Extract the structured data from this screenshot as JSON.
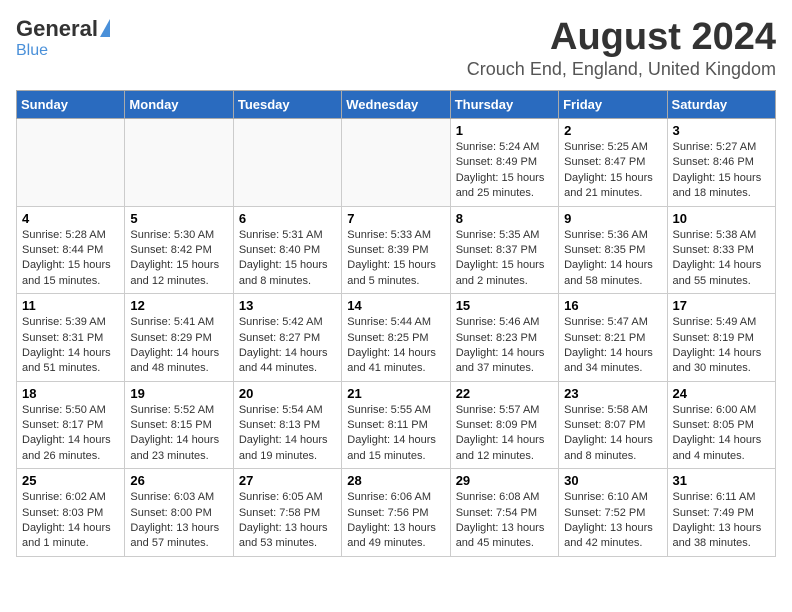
{
  "logo": {
    "general": "General",
    "blue": "Blue"
  },
  "header": {
    "month_year": "August 2024",
    "location": "Crouch End, England, United Kingdom"
  },
  "days_of_week": [
    "Sunday",
    "Monday",
    "Tuesday",
    "Wednesday",
    "Thursday",
    "Friday",
    "Saturday"
  ],
  "weeks": [
    [
      {
        "day": "",
        "info": ""
      },
      {
        "day": "",
        "info": ""
      },
      {
        "day": "",
        "info": ""
      },
      {
        "day": "",
        "info": ""
      },
      {
        "day": "1",
        "info": "Sunrise: 5:24 AM\nSunset: 8:49 PM\nDaylight: 15 hours and 25 minutes."
      },
      {
        "day": "2",
        "info": "Sunrise: 5:25 AM\nSunset: 8:47 PM\nDaylight: 15 hours and 21 minutes."
      },
      {
        "day": "3",
        "info": "Sunrise: 5:27 AM\nSunset: 8:46 PM\nDaylight: 15 hours and 18 minutes."
      }
    ],
    [
      {
        "day": "4",
        "info": "Sunrise: 5:28 AM\nSunset: 8:44 PM\nDaylight: 15 hours and 15 minutes."
      },
      {
        "day": "5",
        "info": "Sunrise: 5:30 AM\nSunset: 8:42 PM\nDaylight: 15 hours and 12 minutes."
      },
      {
        "day": "6",
        "info": "Sunrise: 5:31 AM\nSunset: 8:40 PM\nDaylight: 15 hours and 8 minutes."
      },
      {
        "day": "7",
        "info": "Sunrise: 5:33 AM\nSunset: 8:39 PM\nDaylight: 15 hours and 5 minutes."
      },
      {
        "day": "8",
        "info": "Sunrise: 5:35 AM\nSunset: 8:37 PM\nDaylight: 15 hours and 2 minutes."
      },
      {
        "day": "9",
        "info": "Sunrise: 5:36 AM\nSunset: 8:35 PM\nDaylight: 14 hours and 58 minutes."
      },
      {
        "day": "10",
        "info": "Sunrise: 5:38 AM\nSunset: 8:33 PM\nDaylight: 14 hours and 55 minutes."
      }
    ],
    [
      {
        "day": "11",
        "info": "Sunrise: 5:39 AM\nSunset: 8:31 PM\nDaylight: 14 hours and 51 minutes."
      },
      {
        "day": "12",
        "info": "Sunrise: 5:41 AM\nSunset: 8:29 PM\nDaylight: 14 hours and 48 minutes."
      },
      {
        "day": "13",
        "info": "Sunrise: 5:42 AM\nSunset: 8:27 PM\nDaylight: 14 hours and 44 minutes."
      },
      {
        "day": "14",
        "info": "Sunrise: 5:44 AM\nSunset: 8:25 PM\nDaylight: 14 hours and 41 minutes."
      },
      {
        "day": "15",
        "info": "Sunrise: 5:46 AM\nSunset: 8:23 PM\nDaylight: 14 hours and 37 minutes."
      },
      {
        "day": "16",
        "info": "Sunrise: 5:47 AM\nSunset: 8:21 PM\nDaylight: 14 hours and 34 minutes."
      },
      {
        "day": "17",
        "info": "Sunrise: 5:49 AM\nSunset: 8:19 PM\nDaylight: 14 hours and 30 minutes."
      }
    ],
    [
      {
        "day": "18",
        "info": "Sunrise: 5:50 AM\nSunset: 8:17 PM\nDaylight: 14 hours and 26 minutes."
      },
      {
        "day": "19",
        "info": "Sunrise: 5:52 AM\nSunset: 8:15 PM\nDaylight: 14 hours and 23 minutes."
      },
      {
        "day": "20",
        "info": "Sunrise: 5:54 AM\nSunset: 8:13 PM\nDaylight: 14 hours and 19 minutes."
      },
      {
        "day": "21",
        "info": "Sunrise: 5:55 AM\nSunset: 8:11 PM\nDaylight: 14 hours and 15 minutes."
      },
      {
        "day": "22",
        "info": "Sunrise: 5:57 AM\nSunset: 8:09 PM\nDaylight: 14 hours and 12 minutes."
      },
      {
        "day": "23",
        "info": "Sunrise: 5:58 AM\nSunset: 8:07 PM\nDaylight: 14 hours and 8 minutes."
      },
      {
        "day": "24",
        "info": "Sunrise: 6:00 AM\nSunset: 8:05 PM\nDaylight: 14 hours and 4 minutes."
      }
    ],
    [
      {
        "day": "25",
        "info": "Sunrise: 6:02 AM\nSunset: 8:03 PM\nDaylight: 14 hours and 1 minute."
      },
      {
        "day": "26",
        "info": "Sunrise: 6:03 AM\nSunset: 8:00 PM\nDaylight: 13 hours and 57 minutes."
      },
      {
        "day": "27",
        "info": "Sunrise: 6:05 AM\nSunset: 7:58 PM\nDaylight: 13 hours and 53 minutes."
      },
      {
        "day": "28",
        "info": "Sunrise: 6:06 AM\nSunset: 7:56 PM\nDaylight: 13 hours and 49 minutes."
      },
      {
        "day": "29",
        "info": "Sunrise: 6:08 AM\nSunset: 7:54 PM\nDaylight: 13 hours and 45 minutes."
      },
      {
        "day": "30",
        "info": "Sunrise: 6:10 AM\nSunset: 7:52 PM\nDaylight: 13 hours and 42 minutes."
      },
      {
        "day": "31",
        "info": "Sunrise: 6:11 AM\nSunset: 7:49 PM\nDaylight: 13 hours and 38 minutes."
      }
    ]
  ]
}
